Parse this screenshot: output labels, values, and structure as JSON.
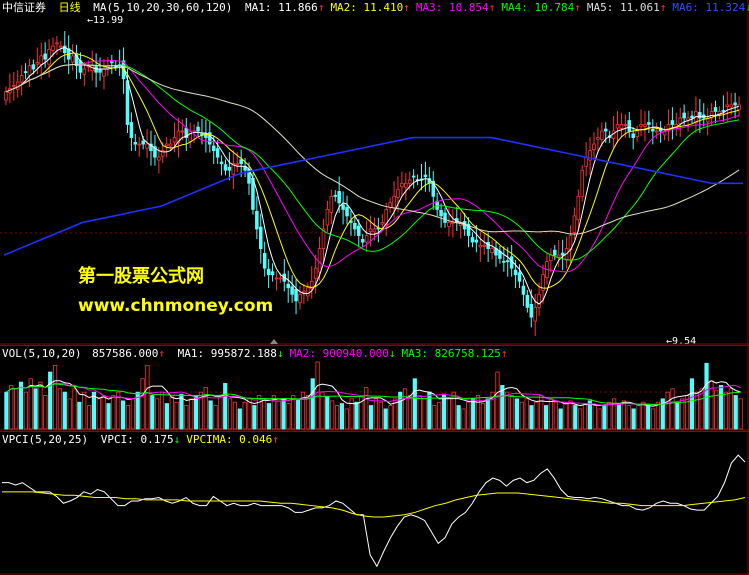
{
  "header": {
    "broker": "中信证券",
    "period": "日线",
    "ma_params": "MA(5,10,20,30,60,120)",
    "items": [
      {
        "label": "MA1:",
        "value": "11.866",
        "arrow": "↑",
        "color": "#ffffff"
      },
      {
        "label": "MA2:",
        "value": "11.410",
        "arrow": "↑",
        "color": "#ffff00"
      },
      {
        "label": "MA3:",
        "value": "10.854",
        "arrow": "↑",
        "color": "#ff00ff"
      },
      {
        "label": "MA4:",
        "value": "10.784",
        "arrow": "↑",
        "color": "#00ff00"
      },
      {
        "label": "MA5:",
        "value": "11.061",
        "arrow": "↑",
        "color": "#dddddd"
      },
      {
        "label": "MA6:",
        "value": "11.324",
        "arrow": "↓",
        "color": "#3050ff"
      }
    ]
  },
  "annotations": {
    "high_label": "13.99",
    "low_label": "9.54"
  },
  "watermark": {
    "line1": "第一股票公式网",
    "line2": "www.chnmoney.com"
  },
  "volume_header": {
    "params": "VOL(5,10,20)",
    "value": "857586.000",
    "arrow": "↑",
    "items": [
      {
        "label": "MA1:",
        "value": "995872.188",
        "arrow": "↓",
        "color": "#ffffff"
      },
      {
        "label": "MA2:",
        "value": "900940.000",
        "arrow": "↓",
        "color": "#ff00ff"
      },
      {
        "label": "MA3:",
        "value": "826758.125",
        "arrow": "↑",
        "color": "#00ff00"
      }
    ]
  },
  "vpci_header": {
    "params": "VPCI(5,20,25)",
    "items": [
      {
        "label": "VPCI:",
        "value": "0.175",
        "arrow": "↓",
        "color": "#ffffff"
      },
      {
        "label": "VPCIMA:",
        "value": "0.046",
        "arrow": "↑",
        "color": "#ffff00"
      }
    ]
  },
  "colors": {
    "up": "#ff3232",
    "down": "#54fcfc",
    "grid": "#8b0000",
    "watermark": "#ffff00"
  },
  "chart_data": [
    {
      "type": "candlestick",
      "title": "MA(5,10,20,30,60,120)",
      "ylim": [
        9.3,
        14.2
      ],
      "x": [
        0,
        1,
        2,
        3,
        4,
        5,
        6,
        7,
        8,
        9,
        10,
        11,
        12,
        13,
        14,
        15,
        16,
        17,
        18,
        19,
        20,
        21,
        22,
        23,
        24,
        25,
        26,
        27,
        28,
        29,
        30,
        31,
        32,
        33,
        34,
        35,
        36,
        37,
        38,
        39,
        40,
        41,
        42,
        43,
        44,
        45,
        46,
        47,
        48,
        49,
        50,
        51,
        52,
        53,
        54,
        55,
        56,
        57,
        58,
        59,
        60,
        61,
        62,
        63,
        64,
        65,
        66,
        67,
        68,
        69,
        70,
        71,
        72,
        73,
        74,
        75,
        76,
        77,
        78,
        79,
        80,
        81,
        82,
        83,
        84,
        85,
        86,
        87,
        88,
        89,
        90,
        91,
        92,
        93,
        94,
        95,
        96,
        97,
        98,
        99,
        100,
        101,
        102,
        103,
        104,
        105,
        106,
        107,
        108,
        109,
        110,
        111,
        112,
        113,
        114,
        115,
        116,
        117,
        118,
        119,
        120,
        121,
        122,
        123,
        124,
        125,
        126,
        127,
        128,
        129,
        130,
        131,
        132,
        133,
        134,
        135,
        136,
        137,
        138,
        139,
        140,
        141,
        142,
        143,
        144,
        145,
        146,
        147,
        148,
        149,
        150,
        151,
        152,
        153,
        154,
        155,
        156,
        157,
        158,
        159,
        160,
        161,
        162,
        163,
        164,
        165,
        166,
        167,
        168,
        169,
        170,
        171,
        172,
        173,
        174,
        175,
        176,
        177,
        178,
        179,
        180,
        181,
        182,
        183,
        184,
        185,
        186,
        187
      ],
      "close": [
        13.1,
        13.15,
        13.2,
        13.25,
        13.35,
        13.4,
        13.5,
        13.45,
        13.55,
        13.65,
        13.6,
        13.75,
        13.8,
        13.85,
        13.8,
        13.7,
        13.6,
        13.65,
        13.5,
        13.4,
        13.45,
        13.5,
        13.5,
        13.4,
        13.4,
        13.45,
        13.5,
        13.55,
        13.5,
        13.5,
        13.3,
        12.6,
        12.4,
        12.3,
        12.3,
        12.3,
        12.3,
        12.2,
        12.1,
        12.1,
        12.2,
        12.3,
        12.3,
        12.4,
        12.5,
        12.5,
        12.4,
        12.5,
        12.5,
        12.5,
        12.45,
        12.4,
        12.3,
        12.2,
        12.1,
        12.0,
        11.9,
        11.9,
        12.0,
        12.0,
        12.0,
        11.9,
        11.7,
        11.3,
        11.0,
        10.7,
        10.4,
        10.3,
        10.3,
        10.25,
        10.25,
        10.2,
        10.1,
        10.0,
        9.9,
        10.0,
        10.05,
        10.1,
        10.2,
        10.4,
        10.7,
        11.0,
        11.3,
        11.5,
        11.5,
        11.4,
        11.3,
        11.2,
        11.1,
        11.0,
        10.9,
        10.8,
        10.9,
        11.0,
        11.0,
        11.0,
        11.1,
        11.3,
        11.4,
        11.5,
        11.6,
        11.7,
        11.7,
        11.75,
        11.8,
        11.75,
        11.75,
        11.8,
        11.7,
        11.5,
        11.3,
        11.2,
        11.1,
        11.1,
        11.1,
        11.1,
        11.1,
        11.0,
        10.9,
        10.8,
        10.8,
        10.75,
        10.75,
        10.7,
        10.7,
        10.6,
        10.55,
        10.5,
        10.5,
        10.4,
        10.3,
        10.2,
        10.0,
        9.8,
        9.65,
        9.8,
        10.0,
        10.3,
        10.5,
        10.6,
        10.6,
        10.6,
        10.6,
        10.7,
        10.9,
        11.2,
        11.5,
        11.9,
        12.1,
        12.2,
        12.3,
        12.4,
        12.5,
        12.5,
        12.4,
        12.5,
        12.6,
        12.6,
        12.6,
        12.5,
        12.4,
        12.5,
        12.6,
        12.6,
        12.6,
        12.5,
        12.5,
        12.5,
        12.5,
        12.6,
        12.6,
        12.6,
        12.7,
        12.7,
        12.7,
        12.7,
        12.8,
        12.7,
        12.7,
        12.7,
        12.8,
        12.8,
        12.8,
        12.8,
        12.9,
        12.9,
        12.9,
        12.9
      ],
      "ma_series": [
        {
          "name": "MA6",
          "color": "#2030ff",
          "values": [
            10.6,
            10.7,
            10.8,
            10.9,
            11.0,
            11.1,
            11.15,
            11.2,
            11.25,
            11.3,
            11.35,
            11.45,
            11.55,
            11.65,
            11.75,
            11.85,
            11.9,
            11.95,
            12.0,
            12.05,
            12.1,
            12.15,
            12.2,
            12.25,
            12.3,
            12.35,
            12.4,
            12.4,
            12.4,
            12.4,
            12.4,
            12.4,
            12.35,
            12.3,
            12.25,
            12.2,
            12.15,
            12.1,
            12.05,
            12.0,
            11.95,
            11.9,
            11.85,
            11.8,
            11.75,
            11.7,
            11.7,
            11.7
          ]
        }
      ]
    },
    {
      "type": "bar",
      "title": "VOL(5,10,20)",
      "values": [
        0.55,
        0.65,
        0.6,
        0.7,
        0.55,
        0.75,
        0.6,
        0.7,
        0.5,
        0.85,
        0.95,
        0.6,
        0.55,
        0.45,
        0.6,
        0.4,
        0.55,
        0.35,
        0.55,
        0.45,
        0.5,
        0.38,
        0.5,
        0.55,
        0.42,
        0.35,
        0.45,
        0.55,
        0.75,
        0.95,
        0.5,
        0.45,
        0.55,
        0.38,
        0.48,
        0.4,
        0.52,
        0.35,
        0.45,
        0.5,
        0.55,
        0.62,
        0.42,
        0.35,
        0.5,
        0.68,
        0.45,
        0.4,
        0.3,
        0.4,
        0.45,
        0.35,
        0.5,
        0.45,
        0.38,
        0.5,
        0.42,
        0.45,
        0.38,
        0.5,
        0.45,
        0.55,
        0.5,
        0.75,
        1.0,
        0.55,
        0.48,
        0.42,
        0.35,
        0.38,
        0.3,
        0.45,
        0.4,
        0.5,
        0.62,
        0.35,
        0.45,
        0.4,
        0.3,
        0.35,
        0.45,
        0.55,
        0.6,
        0.5,
        0.75,
        0.5,
        0.45,
        0.55,
        0.35,
        0.4,
        0.52,
        0.45,
        0.55,
        0.35,
        0.3,
        0.4,
        0.45,
        0.5,
        0.38,
        0.45,
        0.55,
        0.85,
        0.65,
        0.55,
        0.5,
        0.45,
        0.4,
        0.45,
        0.35,
        0.4,
        0.5,
        0.35,
        0.45,
        0.4,
        0.3,
        0.38,
        0.42,
        0.35,
        0.3,
        0.38,
        0.42,
        0.35,
        0.3,
        0.35,
        0.4,
        0.45,
        0.38,
        0.42,
        0.35,
        0.3,
        0.35,
        0.4,
        0.35,
        0.3,
        0.4,
        0.45,
        0.55,
        0.6,
        0.4,
        0.45,
        0.5,
        0.75,
        0.55,
        0.6,
        0.98,
        0.72,
        0.58,
        0.65,
        0.55,
        0.6,
        0.5,
        0.45
      ]
    },
    {
      "type": "line",
      "title": "VPCI(5,20,25)",
      "series": [
        {
          "name": "VPCI",
          "color": "#ffffff",
          "values": [
            0.18,
            0.18,
            0.16,
            0.18,
            0.14,
            0.1,
            0.1,
            0.1,
            0.06,
            0.0,
            0.02,
            0.05,
            0.1,
            0.08,
            0.12,
            0.1,
            0.04,
            -0.02,
            -0.02,
            0.02,
            0.02,
            0.04,
            0.04,
            0.05,
            0.02,
            0.0,
            0.02,
            0.05,
            0.0,
            -0.02,
            -0.02,
            0.06,
            0.02,
            -0.02,
            0.0,
            -0.02,
            -0.02,
            0.0,
            -0.02,
            -0.02,
            -0.02,
            -0.02,
            -0.04,
            -0.08,
            -0.08,
            -0.06,
            -0.04,
            -0.04,
            -0.02,
            0.02,
            0.0,
            -0.05,
            -0.1,
            -0.1,
            -0.45,
            -0.55,
            -0.42,
            -0.3,
            -0.2,
            -0.12,
            -0.1,
            -0.12,
            -0.15,
            -0.25,
            -0.35,
            -0.3,
            -0.18,
            -0.12,
            -0.08,
            0.0,
            0.1,
            0.18,
            0.22,
            0.2,
            0.15,
            0.2,
            0.22,
            0.18,
            0.2,
            0.26,
            0.3,
            0.22,
            0.12,
            0.06,
            0.05,
            0.05,
            0.04,
            0.05,
            0.04,
            0.02,
            0.0,
            -0.02,
            -0.02,
            -0.05,
            -0.06,
            -0.04,
            0.0,
            0.02,
            0.0,
            0.0,
            -0.02,
            -0.05,
            -0.06,
            -0.06,
            0.0,
            0.06,
            0.18,
            0.35,
            0.42,
            0.36
          ]
        },
        {
          "name": "VPCIMA",
          "color": "#ffff00",
          "values": [
            0.1,
            0.1,
            0.1,
            0.1,
            0.09,
            0.08,
            0.07,
            0.07,
            0.06,
            0.05,
            0.05,
            0.05,
            0.04,
            0.04,
            0.03,
            0.03,
            0.03,
            0.03,
            0.02,
            0.02,
            0.02,
            0.02,
            0.02,
            0.02,
            0.02,
            0.02,
            0.01,
            0.0,
            0.0,
            -0.01,
            -0.02,
            -0.03,
            -0.04,
            -0.06,
            -0.09,
            -0.11,
            -0.12,
            -0.12,
            -0.11,
            -0.1,
            -0.08,
            -0.05,
            -0.02,
            0.0,
            0.03,
            0.05,
            0.07,
            0.08,
            0.09,
            0.09,
            0.09,
            0.08,
            0.07,
            0.06,
            0.05,
            0.04,
            0.03,
            0.02,
            0.01,
            0.0,
            0.0,
            -0.01,
            -0.02,
            -0.02,
            -0.02,
            -0.02,
            -0.02,
            -0.01,
            0.0,
            0.01,
            0.02,
            0.03,
            0.05
          ]
        }
      ],
      "ylim": [
        -0.6,
        0.5
      ]
    }
  ]
}
